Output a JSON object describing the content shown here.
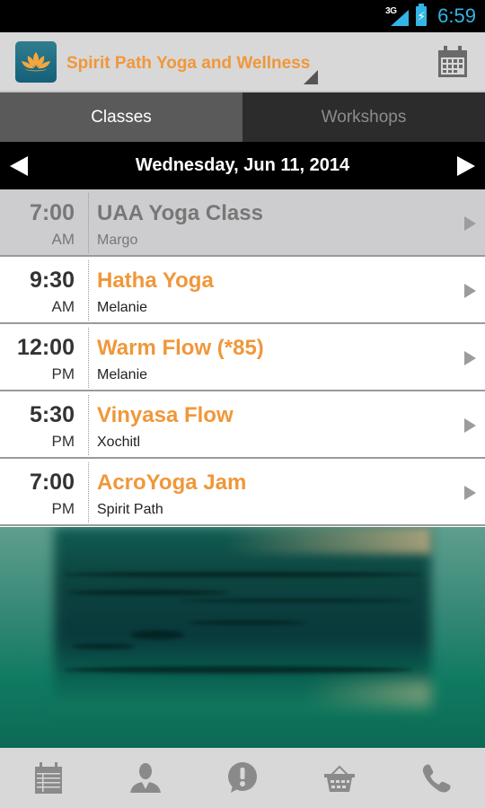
{
  "status_bar": {
    "network": "3G",
    "time": "6:59",
    "battery_state": "charging"
  },
  "action_bar": {
    "app_title": "Spirit Path Yoga and Wellness",
    "logo_icon": "lotus-icon",
    "calendar_icon": "calendar-icon"
  },
  "tabs": [
    {
      "label": "Classes",
      "active": true
    },
    {
      "label": "Workshops",
      "active": false
    }
  ],
  "date_nav": {
    "date": "Wednesday, Jun 11, 2014",
    "prev_icon": "arrow-left-icon",
    "next_icon": "arrow-right-icon"
  },
  "classes": [
    {
      "time": "7:00",
      "ampm": "AM",
      "name": "UAA Yoga Class",
      "instructor": "Margo",
      "past": true
    },
    {
      "time": "9:30",
      "ampm": "AM",
      "name": "Hatha Yoga",
      "instructor": "Melanie",
      "past": false
    },
    {
      "time": "12:00",
      "ampm": "PM",
      "name": "Warm Flow (*85)",
      "instructor": "Melanie",
      "past": false
    },
    {
      "time": "5:30",
      "ampm": "PM",
      "name": "Vinyasa Flow",
      "instructor": "Xochitl",
      "past": false
    },
    {
      "time": "7:00",
      "ampm": "PM",
      "name": "AcroYoga Jam",
      "instructor": "Spirit Path",
      "past": false
    }
  ],
  "bottom_nav": [
    {
      "icon": "schedule-icon"
    },
    {
      "icon": "staff-icon"
    },
    {
      "icon": "alert-icon"
    },
    {
      "icon": "shop-basket-icon"
    },
    {
      "icon": "phone-icon"
    }
  ],
  "colors": {
    "accent": "#f0973a",
    "status_blue": "#33b5e5"
  }
}
